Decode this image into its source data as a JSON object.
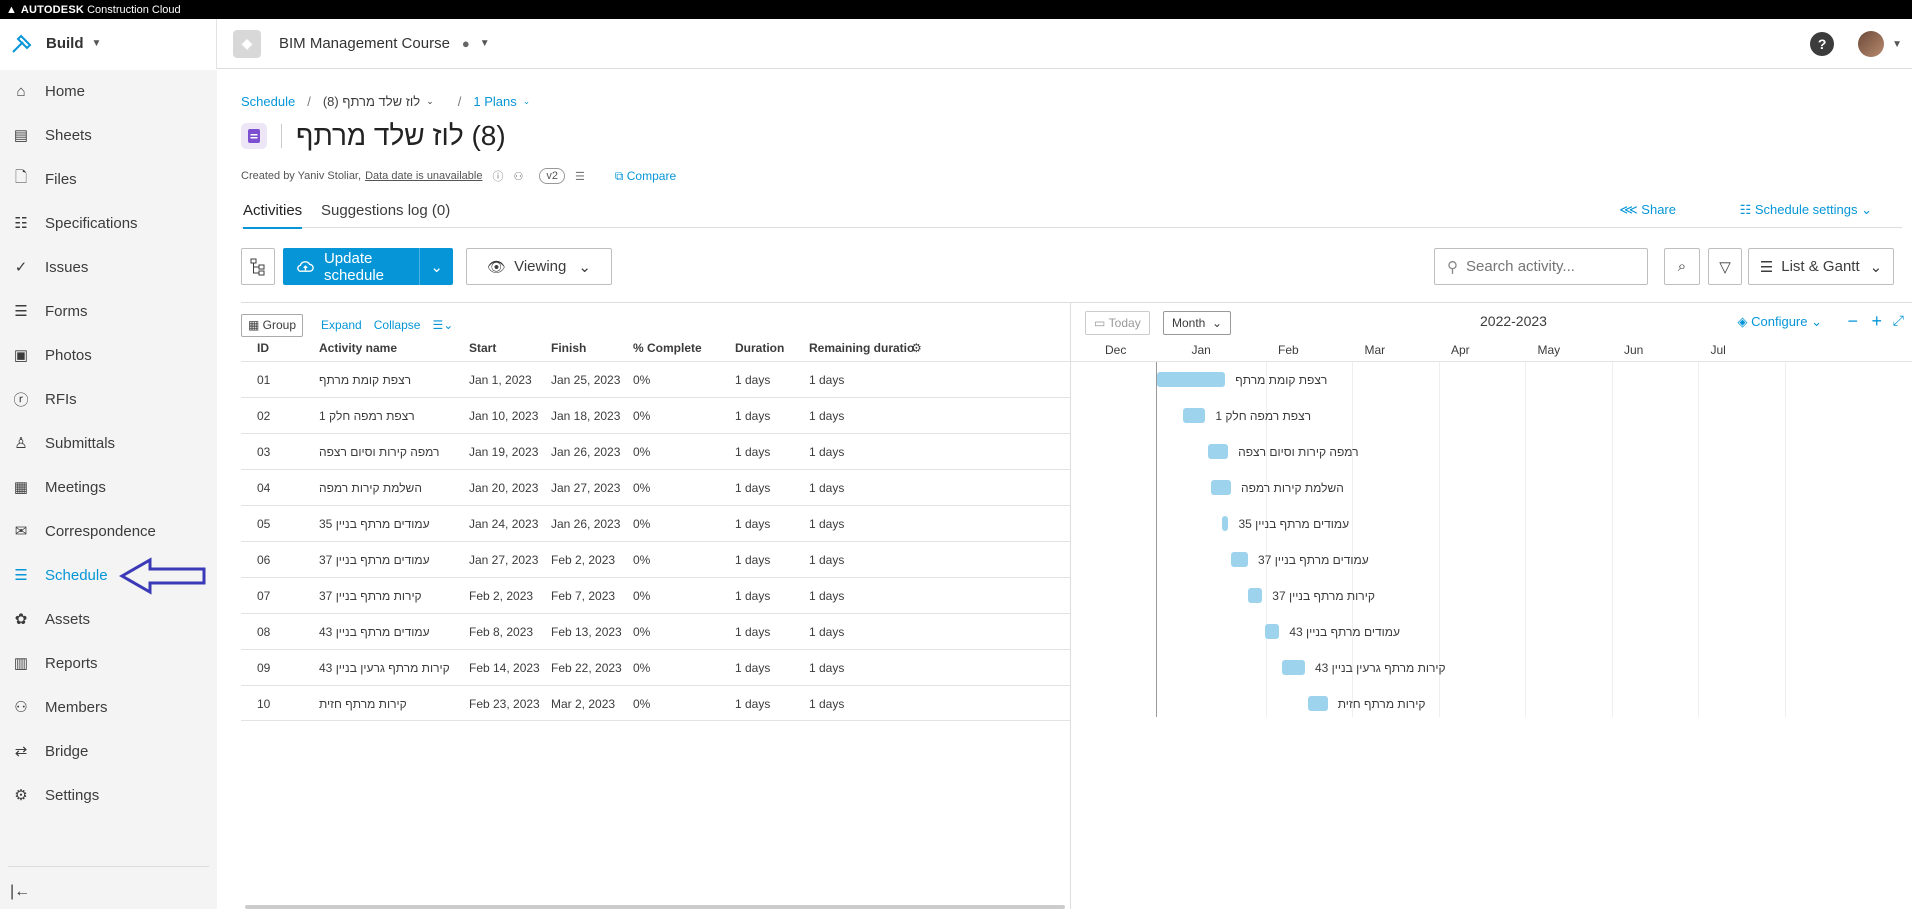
{
  "topbar": {
    "brand_bold": "AUTODESK",
    "brand_rest": " Construction Cloud"
  },
  "header": {
    "product": "Build",
    "project": "BIM Management Course"
  },
  "sidebar": {
    "items": [
      {
        "label": "Home",
        "icon": "home-icon"
      },
      {
        "label": "Sheets",
        "icon": "sheets-icon"
      },
      {
        "label": "Files",
        "icon": "files-icon"
      },
      {
        "label": "Specifications",
        "icon": "specifications-icon"
      },
      {
        "label": "Issues",
        "icon": "issues-icon"
      },
      {
        "label": "Forms",
        "icon": "forms-icon"
      },
      {
        "label": "Photos",
        "icon": "photos-icon"
      },
      {
        "label": "RFIs",
        "icon": "rfis-icon"
      },
      {
        "label": "Submittals",
        "icon": "submittals-icon"
      },
      {
        "label": "Meetings",
        "icon": "meetings-icon"
      },
      {
        "label": "Correspondence",
        "icon": "correspondence-icon"
      },
      {
        "label": "Schedule",
        "icon": "schedule-icon",
        "active": true
      },
      {
        "label": "Assets",
        "icon": "assets-icon"
      },
      {
        "label": "Reports",
        "icon": "reports-icon"
      },
      {
        "label": "Members",
        "icon": "members-icon"
      },
      {
        "label": "Bridge",
        "icon": "bridge-icon"
      },
      {
        "label": "Settings",
        "icon": "settings-icon"
      }
    ]
  },
  "breadcrumb": {
    "root": "Schedule",
    "current": "(8) לוז שלד מרתף",
    "plans": "1 Plans"
  },
  "page": {
    "title": "(8) לוז שלד מרתף",
    "created_by": "Created by Yaniv Stoliar,",
    "data_date": "Data date is unavailable",
    "version": "v2",
    "compare": "Compare"
  },
  "tabs": {
    "activities": "Activities",
    "suggestions": "Suggestions log (0)",
    "share": "Share",
    "schedule_settings": "Schedule settings"
  },
  "toolbar": {
    "update": "Update schedule",
    "viewing": "Viewing",
    "search_placeholder": "Search activity...",
    "view_mode": "List & Gantt"
  },
  "grid": {
    "group": "Group",
    "expand": "Expand",
    "collapse": "Collapse",
    "columns": {
      "id": "ID",
      "name": "Activity name",
      "start": "Start",
      "finish": "Finish",
      "complete": "% Complete",
      "duration": "Duration",
      "remaining": "Remaining duratio"
    },
    "rows": [
      {
        "id": "01",
        "name": "רצפת קומת מרתף",
        "start": "Jan 1, 2023",
        "finish": "Jan 25, 2023",
        "complete": "0%",
        "duration": "1 days",
        "remaining": "1 days"
      },
      {
        "id": "02",
        "name": "רצפת רמפה חלק 1",
        "start": "Jan 10, 2023",
        "finish": "Jan 18, 2023",
        "complete": "0%",
        "duration": "1 days",
        "remaining": "1 days"
      },
      {
        "id": "03",
        "name": "רמפה קירות וסיום רצפה",
        "start": "Jan 19, 2023",
        "finish": "Jan 26, 2023",
        "complete": "0%",
        "duration": "1 days",
        "remaining": "1 days"
      },
      {
        "id": "04",
        "name": "השלמת קירות רמפה",
        "start": "Jan 20, 2023",
        "finish": "Jan 27, 2023",
        "complete": "0%",
        "duration": "1 days",
        "remaining": "1 days"
      },
      {
        "id": "05",
        "name": "עמודים מרתף בניין 35",
        "start": "Jan 24, 2023",
        "finish": "Jan 26, 2023",
        "complete": "0%",
        "duration": "1 days",
        "remaining": "1 days"
      },
      {
        "id": "06",
        "name": "עמודים מרתף בניין 37",
        "start": "Jan 27, 2023",
        "finish": "Feb 2, 2023",
        "complete": "0%",
        "duration": "1 days",
        "remaining": "1 days"
      },
      {
        "id": "07",
        "name": "קירות מרתף בניין 37",
        "start": "Feb 2, 2023",
        "finish": "Feb 7, 2023",
        "complete": "0%",
        "duration": "1 days",
        "remaining": "1 days"
      },
      {
        "id": "08",
        "name": "עמודים מרתף בניין 43",
        "start": "Feb 8, 2023",
        "finish": "Feb 13, 2023",
        "complete": "0%",
        "duration": "1 days",
        "remaining": "1 days"
      },
      {
        "id": "09",
        "name": "קירות מרתף גרעין בניין 43",
        "start": "Feb 14, 2023",
        "finish": "Feb 22, 2023",
        "complete": "0%",
        "duration": "1 days",
        "remaining": "1 days"
      },
      {
        "id": "10",
        "name": "קירות מרתף חזית",
        "start": "Feb 23, 2023",
        "finish": "Mar 2, 2023",
        "complete": "0%",
        "duration": "1 days",
        "remaining": "1 days"
      }
    ]
  },
  "gantt": {
    "today": "Today",
    "scale": "Month",
    "range": "2022-2023",
    "configure": "Configure",
    "months": [
      "Dec",
      "Jan",
      "Feb",
      "Mar",
      "Apr",
      "May",
      "Jun",
      "Jul"
    ],
    "bar_color": "#9dd3ec"
  },
  "colors": {
    "accent": "#0696d7",
    "annotation_arrow": "#3a3ab8"
  }
}
